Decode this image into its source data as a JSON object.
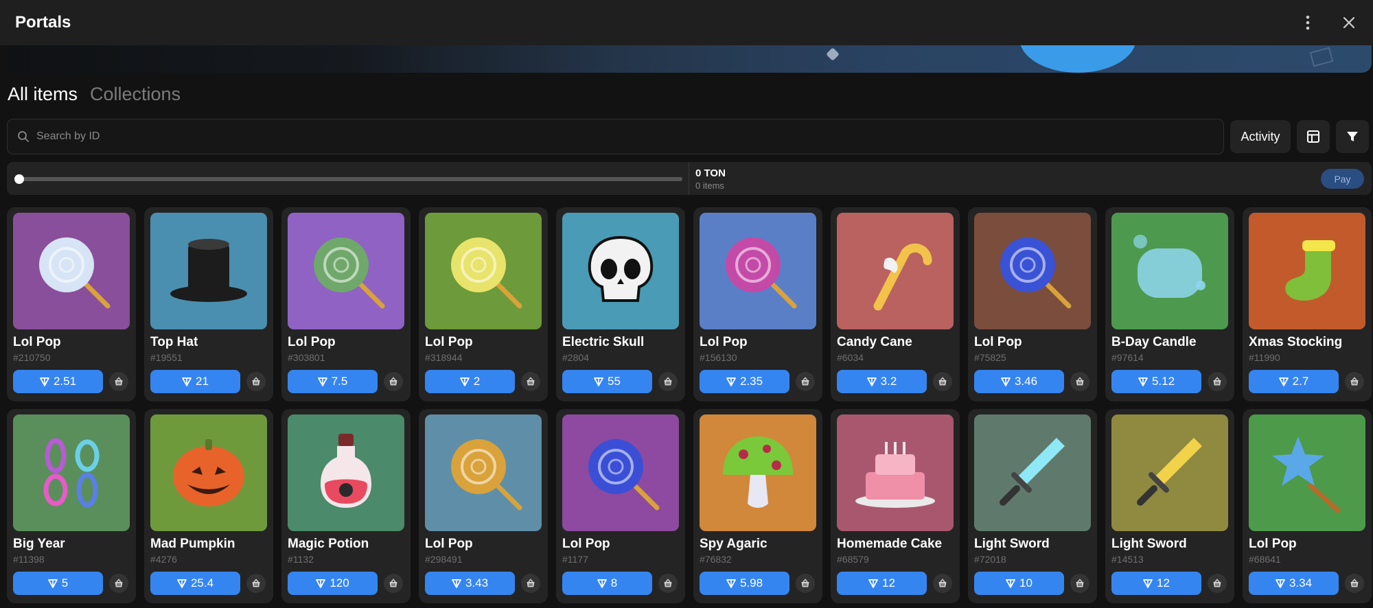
{
  "window": {
    "title": "Portals"
  },
  "tabs": [
    {
      "label": "All items",
      "active": true
    },
    {
      "label": "Collections",
      "active": false
    }
  ],
  "search": {
    "placeholder": "Search by ID",
    "value": ""
  },
  "toolbar": {
    "activity_label": "Activity"
  },
  "cart_bar": {
    "total": "0 TON",
    "count": "0 items",
    "pay_label": "Pay"
  },
  "colors": {
    "accent": "#3585f0",
    "background": "#121212",
    "card": "#242424"
  },
  "items": [
    {
      "name": "Lol Pop",
      "id": "#210750",
      "price": "2.51",
      "bg": "#8a4f9a",
      "icon": "lollipop-icon",
      "art": "#d7e4f5"
    },
    {
      "name": "Top Hat",
      "id": "#19551",
      "price": "21",
      "bg": "#4a8fb0",
      "icon": "top-hat-icon",
      "art": "#1c1c1c"
    },
    {
      "name": "Lol Pop",
      "id": "#303801",
      "price": "7.5",
      "bg": "#8f62c4",
      "icon": "lollipop-icon",
      "art": "#6fa86a"
    },
    {
      "name": "Lol Pop",
      "id": "#318944",
      "price": "2",
      "bg": "#6d9a3a",
      "icon": "lollipop-icon",
      "art": "#e8e36a"
    },
    {
      "name": "Electric Skull",
      "id": "#2804",
      "price": "55",
      "bg": "#4a9bb5",
      "icon": "skull-icon",
      "art": "#f2f2f2"
    },
    {
      "name": "Lol Pop",
      "id": "#156130",
      "price": "2.35",
      "bg": "#5a7fc7",
      "icon": "lollipop-icon",
      "art": "#c44aa8"
    },
    {
      "name": "Candy Cane",
      "id": "#6034",
      "price": "3.2",
      "bg": "#b9625f",
      "icon": "candy-cane-icon",
      "art": "#f2c24a"
    },
    {
      "name": "Lol Pop",
      "id": "#75825",
      "price": "3.46",
      "bg": "#7a4d3d",
      "icon": "lollipop-icon",
      "art": "#3a52d6"
    },
    {
      "name": "B-Day Candle",
      "id": "#97614",
      "price": "5.12",
      "bg": "#4d9a4f",
      "icon": "candle-icon",
      "art": "#8fd7f0"
    },
    {
      "name": "Xmas Stocking",
      "id": "#11990",
      "price": "2.7",
      "bg": "#c25a2c",
      "icon": "stocking-icon",
      "art": "#7fbf3a"
    },
    {
      "name": "Big Year",
      "id": "#11398",
      "price": "5",
      "bg": "#5a8f5c",
      "icon": "big-year-icon",
      "art": "#b95ad6"
    },
    {
      "name": "Mad Pumpkin",
      "id": "#4276",
      "price": "25.4",
      "bg": "#6f9a3c",
      "icon": "pumpkin-icon",
      "art": "#e8632a"
    },
    {
      "name": "Magic Potion",
      "id": "#1132",
      "price": "120",
      "bg": "#4b8a6a",
      "icon": "potion-icon",
      "art": "#e84a5f"
    },
    {
      "name": "Lol Pop",
      "id": "#298491",
      "price": "3.43",
      "bg": "#5f8fa8",
      "icon": "lollipop-icon",
      "art": "#d9a23a"
    },
    {
      "name": "Lol Pop",
      "id": "#1177",
      "price": "8",
      "bg": "#8d4aa0",
      "icon": "lollipop-icon",
      "art": "#3a4fd6"
    },
    {
      "name": "Spy Agaric",
      "id": "#76832",
      "price": "5.98",
      "bg": "#d2883a",
      "icon": "mushroom-icon",
      "art": "#7ac93a"
    },
    {
      "name": "Homemade Cake",
      "id": "#68579",
      "price": "12",
      "bg": "#a9576f",
      "icon": "cake-icon",
      "art": "#f08fa8"
    },
    {
      "name": "Light Sword",
      "id": "#72018",
      "price": "10",
      "bg": "#5f7a6c",
      "icon": "sword-icon",
      "art": "#8fe8f5"
    },
    {
      "name": "Light Sword",
      "id": "#14513",
      "price": "12",
      "bg": "#8f8a3f",
      "icon": "sword-icon",
      "art": "#f2d24a"
    },
    {
      "name": "Lol Pop",
      "id": "#68641",
      "price": "3.34",
      "bg": "#4d9a4a",
      "icon": "star-wand-icon",
      "art": "#5aa8e8"
    }
  ]
}
